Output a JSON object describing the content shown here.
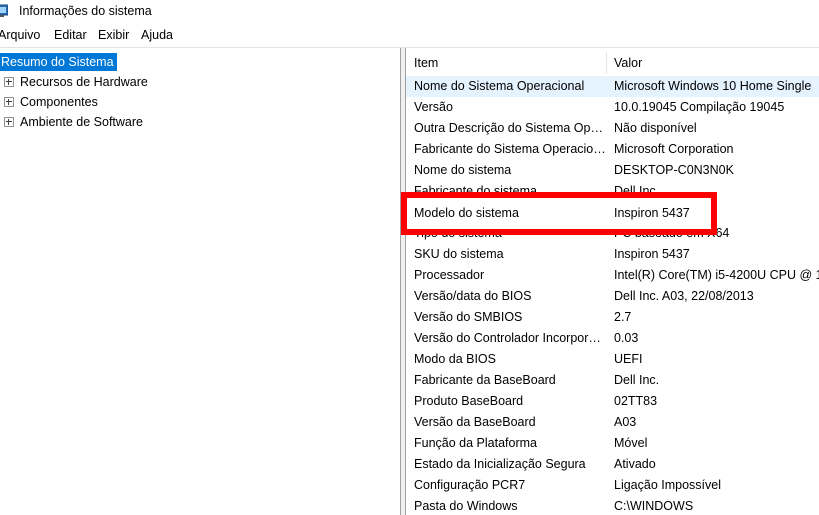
{
  "window": {
    "title": "Informações do sistema",
    "icon": "system-info-icon"
  },
  "menu": [
    "Arquivo",
    "Editar",
    "Exibir",
    "Ajuda"
  ],
  "tree": {
    "root": "Resumo do Sistema",
    "children": [
      "Recursos de Hardware",
      "Componentes",
      "Ambiente de Software"
    ]
  },
  "list": {
    "headers": {
      "item": "Item",
      "value": "Valor"
    },
    "rows": [
      {
        "item": "Nome do Sistema Operacional",
        "value": "Microsoft Windows 10 Home Single"
      },
      {
        "item": "Versão",
        "value": "10.0.19045 Compilação 19045"
      },
      {
        "item": "Outra Descrição do Sistema Operacional",
        "value": "Não disponível"
      },
      {
        "item": "Fabricante do Sistema Operacional",
        "value": "Microsoft Corporation"
      },
      {
        "item": "Nome do sistema",
        "value": "DESKTOP-C0N3N0K"
      },
      {
        "item": "Fabricante do sistema",
        "value": "Dell Inc."
      },
      {
        "item": "Modelo do sistema",
        "value": "Inspiron 5437"
      },
      {
        "item": "Tipo do sistema",
        "value": "PC baseado em X64"
      },
      {
        "item": "SKU do sistema",
        "value": "Inspiron 5437"
      },
      {
        "item": "Processador",
        "value": "Intel(R) Core(TM) i5-4200U CPU @ 1"
      },
      {
        "item": "Versão/data do BIOS",
        "value": "Dell Inc. A03, 22/08/2013"
      },
      {
        "item": "Versão do SMBIOS",
        "value": "2.7"
      },
      {
        "item": "Versão do Controlador Incorporado",
        "value": "0.03"
      },
      {
        "item": "Modo da BIOS",
        "value": "UEFI"
      },
      {
        "item": "Fabricante da BaseBoard",
        "value": "Dell Inc."
      },
      {
        "item": "Produto BaseBoard",
        "value": "02TT83"
      },
      {
        "item": "Versão da BaseBoard",
        "value": "A03"
      },
      {
        "item": "Função da Plataforma",
        "value": "Móvel"
      },
      {
        "item": "Estado da Inicialização Segura",
        "value": "Ativado"
      },
      {
        "item": "Configuração PCR7",
        "value": "Ligação Impossível"
      },
      {
        "item": "Pasta do Windows",
        "value": "C:\\WINDOWS"
      }
    ],
    "selected_row": 0,
    "highlighted_row": 6
  },
  "colors": {
    "selection": "#0078d7",
    "row_selected": "#e5f3ff",
    "highlight_border": "#ff0000"
  }
}
